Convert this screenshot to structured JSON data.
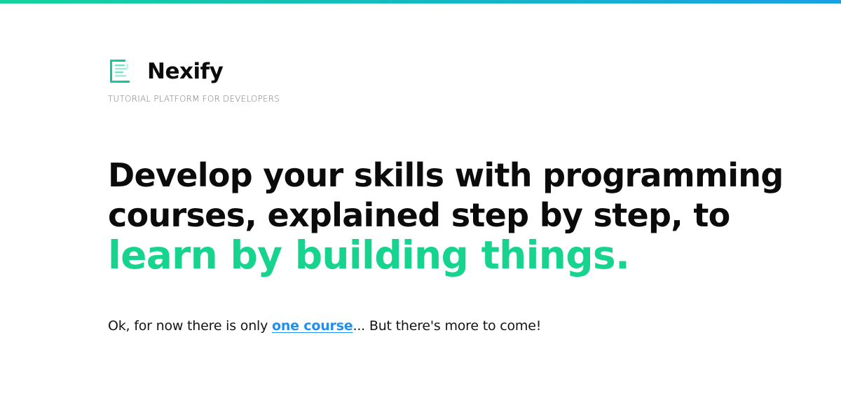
{
  "page": {
    "accent_color": "#16d48e",
    "link_color": "#1f8ff0",
    "top_bar_gradient": [
      "#14d39a",
      "#1aa0e6"
    ]
  },
  "brand": {
    "name": "Nexify",
    "tagline": "TUTORIAL PLATFORM FOR DEVELOPERS",
    "icon": "document-lines-icon"
  },
  "hero": {
    "headline_text": "Develop your skills with programming courses, explained step by step, to ",
    "headline_accent": "learn by building things."
  },
  "intro": {
    "before_link": "Ok, for now there is only ",
    "link_text": "one course",
    "after_link": "... But there's more to come!"
  }
}
